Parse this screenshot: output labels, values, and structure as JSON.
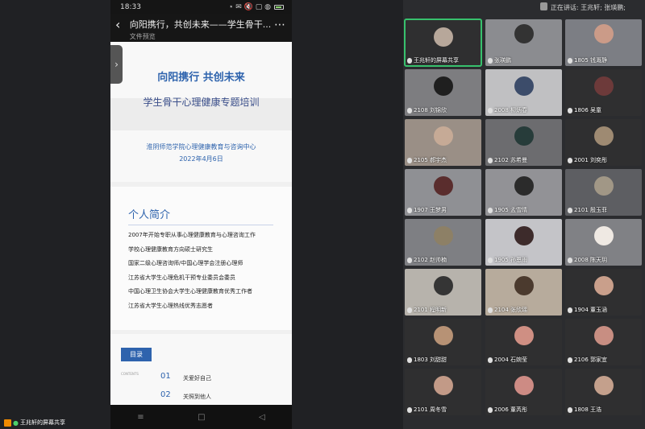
{
  "phone": {
    "status_time": "18:33",
    "status_right": "⋆ ✉ 🔇 ▢ ◍",
    "header_title": "向阳携行，共创未来——学生骨干...",
    "header_sub": "文件预览",
    "back_icon": "‹",
    "more_icon": "⋯",
    "toggle_icon": "›"
  },
  "slide1": {
    "head": "向阳携行  共创未来",
    "title": "学生骨干心理健康专题培训",
    "org": "淮阴师范学院心理健康教育与咨询中心",
    "date": "2022年4月6日"
  },
  "slide2": {
    "head": "个人简介",
    "items": [
      "2007年开始专职从事心理健康教育与心理咨询工作",
      "学校心理健康教育方向硕士研究生",
      "国家二级心理咨询师/中国心理学会注册心理师",
      "江苏省大学生心理危机干预专业委员会委员",
      "中国心理卫生协会大学生心理健康教育优秀工作者",
      "江苏省大学生心理热线优秀志愿者"
    ]
  },
  "slide3": {
    "badge": "目录",
    "small": "CONTENTS",
    "items": [
      {
        "num": "01",
        "label": "关爱好自己"
      },
      {
        "num": "02",
        "label": "关照到他人"
      }
    ]
  },
  "nav": {
    "menu": "≡",
    "home": "□",
    "back": "◁"
  },
  "share_badge": "王兆轩的屏幕共享",
  "speaking": "正在讲话: 王兆轩; 张瑛鹏;",
  "participants": [
    {
      "name": "王兆轩的屏幕共享",
      "highlight": true
    },
    {
      "name": "张瑛鹏"
    },
    {
      "name": "1805 钱溉静"
    },
    {
      "name": "2108 刘锦欣"
    },
    {
      "name": "2008 柳炳春"
    },
    {
      "name": "1806 吴童"
    },
    {
      "name": "2105 郝宇杰"
    },
    {
      "name": "2102 苏希曼"
    },
    {
      "name": "2001 刘奕彤"
    },
    {
      "name": "1907 王梦男"
    },
    {
      "name": "1905 孟雪晴"
    },
    {
      "name": "2101 殷玉菲"
    },
    {
      "name": "2102 赵帅楠"
    },
    {
      "name": "1905 孙恩雨"
    },
    {
      "name": "2008 陈天玥"
    },
    {
      "name": "2101 程明新"
    },
    {
      "name": "2104 张欣瑶"
    },
    {
      "name": "1904 董玉涵"
    },
    {
      "name": "1803 刘甜甜"
    },
    {
      "name": "2004 石婉莹"
    },
    {
      "name": "2106 郭家宜"
    },
    {
      "name": "2101 周冬雪"
    },
    {
      "name": "2006 董芮彤"
    },
    {
      "name": "1808 王浩"
    }
  ],
  "colors": {
    "accent": "#2e63ad",
    "active_border": "#37c16d"
  }
}
